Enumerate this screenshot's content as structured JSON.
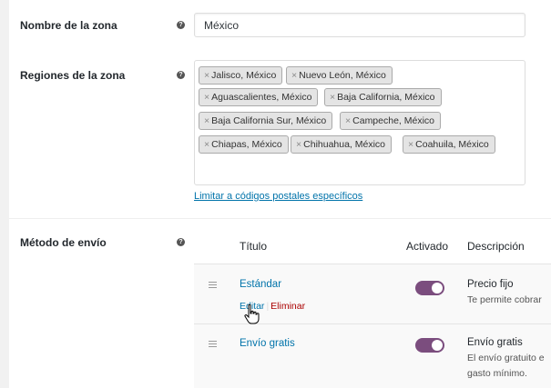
{
  "zone_name": {
    "label": "Nombre de la zona",
    "value": "México"
  },
  "zone_regions": {
    "label": "Regiones de la zona",
    "chips": [
      "Jalisco, México",
      "Nuevo León, México",
      "Aguascalientes, México",
      "Baja California, México",
      "Baja California Sur, México",
      "Campeche, México",
      "Chiapas, México",
      "Chihuahua, México",
      "Coahuila, México"
    ],
    "limit_link": "Limitar a códigos postales específicos"
  },
  "shipping": {
    "label": "Método de envío",
    "columns": {
      "title": "Título",
      "enabled": "Activado",
      "description": "Descripción"
    },
    "methods": [
      {
        "title": "Estándar",
        "enabled": true,
        "edit": "Editar",
        "delete": "Eliminar",
        "desc_title": "Precio fijo",
        "desc_body": "Te permite cobrar"
      },
      {
        "title": "Envío gratis",
        "enabled": true,
        "desc_title": "Envío gratis",
        "desc_body": "El envío gratuito e gasto mínimo."
      }
    ]
  },
  "colors": {
    "accent": "#7b4d7e",
    "link": "#0073aa",
    "delete": "#aa0000"
  },
  "help_icon_glyph": "?",
  "chip_remove_glyph": "×",
  "drag_icon": "hamburger-icon"
}
